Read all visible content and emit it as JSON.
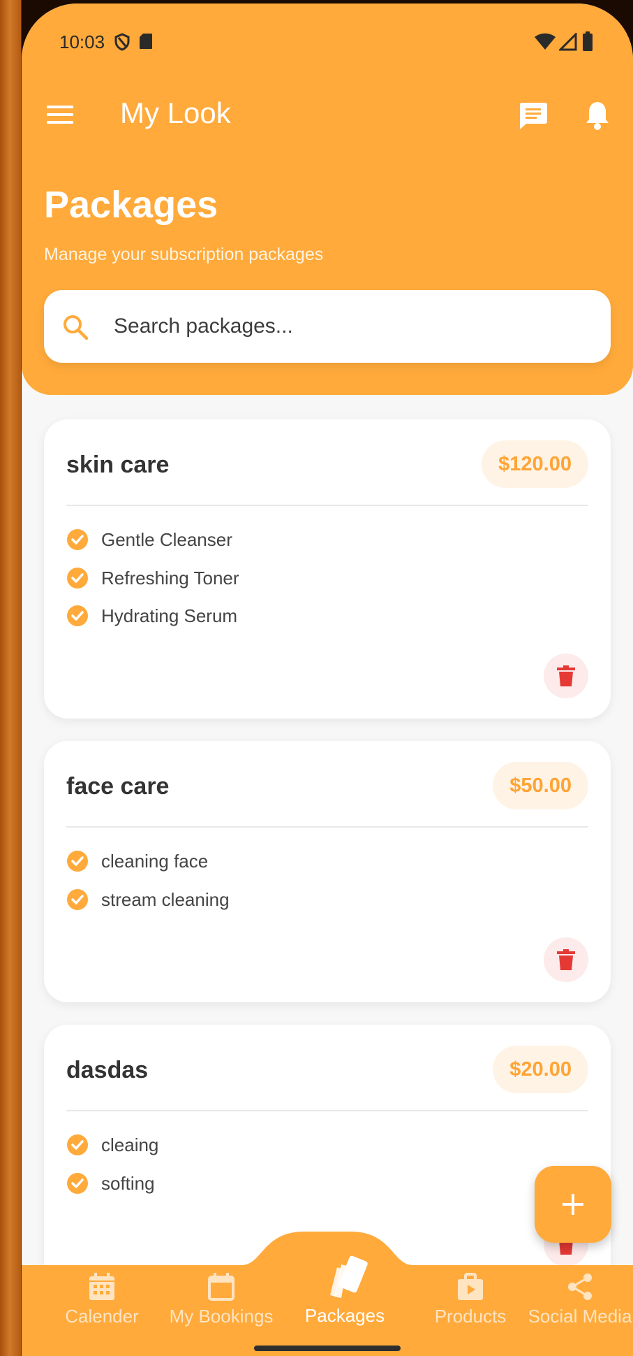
{
  "status_bar": {
    "time": "10:03"
  },
  "app_bar": {
    "title": "My Look"
  },
  "page": {
    "title": "Packages",
    "subtitle": "Manage your subscription packages"
  },
  "search": {
    "placeholder": "Search packages..."
  },
  "packages": [
    {
      "name": "skin care",
      "price": "$120.00",
      "features": [
        "Gentle Cleanser",
        "Refreshing Toner",
        "Hydrating Serum"
      ]
    },
    {
      "name": "face care",
      "price": "$50.00",
      "features": [
        "cleaning face",
        "stream cleaning"
      ]
    },
    {
      "name": "dasdas",
      "price": "$20.00",
      "features": [
        "cleaing",
        "softing"
      ]
    }
  ],
  "nav": [
    {
      "label": "Calender",
      "icon": "calendar-grid-icon"
    },
    {
      "label": "My Bookings",
      "icon": "calendar-icon"
    },
    {
      "label": "Packages",
      "icon": "packages-icon",
      "active": true
    },
    {
      "label": "Products",
      "icon": "shopping-bag-icon"
    },
    {
      "label": "Social Media",
      "icon": "share-icon"
    }
  ],
  "colors": {
    "primary": "#ffaa3b",
    "price_text": "#ffa435",
    "price_bg": "#fff3e6",
    "delete": "#e53935",
    "delete_bg": "#fdeaea"
  }
}
